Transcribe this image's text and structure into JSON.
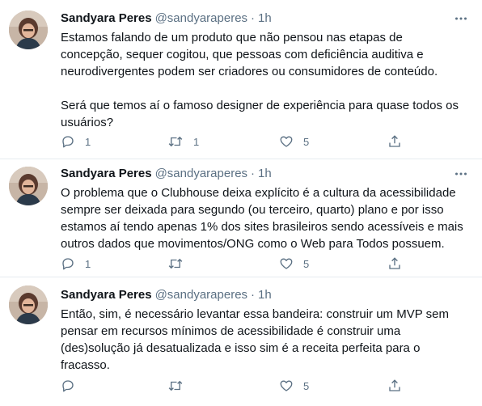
{
  "tweets": [
    {
      "author": {
        "name": "Sandyara Peres",
        "handle": "@sandyaraperes"
      },
      "separator": "·",
      "time": "1h",
      "text": "Estamos falando de um produto que não pensou nas etapas de\nconcepção, sequer cogitou, que pessoas com deficiência auditiva e\nneurodivergentes podem ser criadores ou consumidores de conteúdo.\n\nSerá que temos aí o famoso designer de experiência para quase todos os\nusuários?",
      "actions": {
        "reply_count": "1",
        "retweet_count": "1",
        "like_count": "5"
      }
    },
    {
      "author": {
        "name": "Sandyara Peres",
        "handle": "@sandyaraperes"
      },
      "separator": "·",
      "time": "1h",
      "text": "O problema que o Clubhouse deixa explícito é a cultura da acessibilidade\nsempre ser deixada para segundo (ou terceiro, quarto) plano e por isso\nestamos aí tendo apenas 1% dos sites brasileiros sendo acessíveis e mais\noutros dados que movimentos/ONG como o Web para Todos possuem.",
      "actions": {
        "reply_count": "1",
        "retweet_count": "",
        "like_count": "5"
      }
    },
    {
      "author": {
        "name": "Sandyara Peres",
        "handle": "@sandyaraperes"
      },
      "separator": "·",
      "time": "1h",
      "text": "Então, sim, é necessário levantar essa bandeira: construir um MVP sem\npensar em recursos mínimos de acessibilidade é construir uma\n(des)solução já desatualizada e isso sim é a receita perfeita para o\nfracasso.",
      "actions": {
        "reply_count": "",
        "retweet_count": "",
        "like_count": "5"
      }
    }
  ],
  "icons": {
    "avatar": "avatar-photo",
    "more": "more-horizontal-icon",
    "reply": "reply-icon",
    "retweet": "retweet-icon",
    "like": "heart-icon",
    "share": "share-icon"
  },
  "colors": {
    "text": "#0f1419",
    "secondary": "#5b7083",
    "divider": "#e6ecf0"
  }
}
